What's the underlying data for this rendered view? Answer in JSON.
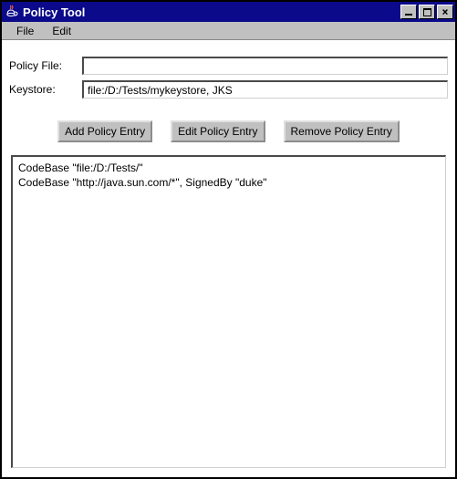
{
  "window": {
    "title": "Policy Tool",
    "icon_name": "java-cup-icon"
  },
  "menu": {
    "items": [
      {
        "label": "File"
      },
      {
        "label": "Edit"
      }
    ]
  },
  "form": {
    "policy_file": {
      "label": "Policy File:",
      "value": ""
    },
    "keystore": {
      "label": "Keystore:",
      "value": "file:/D:/Tests/mykeystore, JKS"
    }
  },
  "buttons": {
    "add": "Add Policy Entry",
    "edit": "Edit Policy Entry",
    "remove": "Remove Policy Entry"
  },
  "policy_entries": [
    "CodeBase \"file:/D:/Tests/\"",
    "CodeBase \"http://java.sun.com/*\", SignedBy \"duke\""
  ]
}
